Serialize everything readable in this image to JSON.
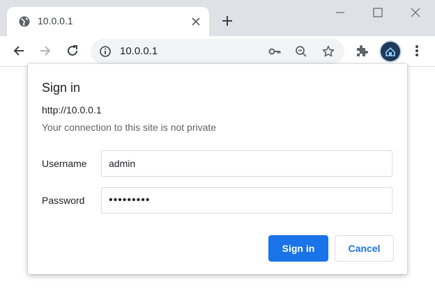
{
  "browser": {
    "tab": {
      "title": "10.0.0.1",
      "favicon": "globe-icon",
      "close_icon": "close-icon"
    },
    "new_tab_icon": "plus-icon",
    "window_controls": [
      "minimize-icon",
      "maximize-icon",
      "close-window-icon"
    ],
    "toolbar": {
      "back_icon": "back-arrow-icon",
      "forward_icon": "forward-arrow-icon",
      "reload_icon": "reload-icon",
      "address": "10.0.0.1",
      "site_info_icon": "info-icon",
      "address_actions": [
        "key-icon",
        "zoom-icon",
        "star-icon"
      ],
      "extensions_icon": "puzzle-icon",
      "menu_icon": "kebab-menu-icon"
    }
  },
  "dialog": {
    "title": "Sign in",
    "origin": "http://10.0.0.1",
    "warning": "Your connection to this site is not private",
    "username_label": "Username",
    "username_value": "admin",
    "password_label": "Password",
    "password_value": "•••••••••",
    "sign_in_label": "Sign in",
    "cancel_label": "Cancel"
  },
  "colors": {
    "accent": "#1a73e8",
    "tab_strip": "#dee1e6",
    "omnibox": "#f1f3f4",
    "icon": "#5f6368"
  }
}
